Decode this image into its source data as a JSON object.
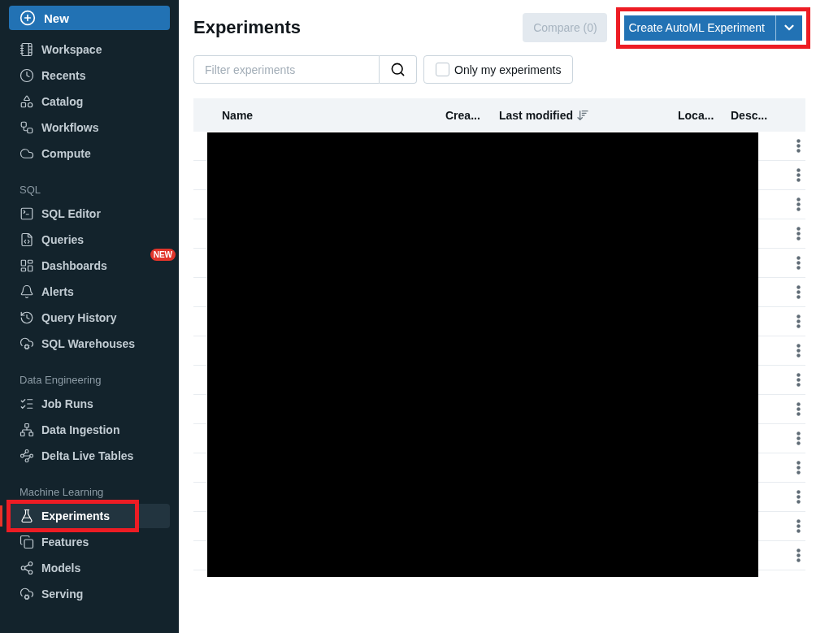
{
  "sidebar": {
    "new_button": {
      "label": "New"
    },
    "sections": [
      {
        "items": [
          {
            "label": "Workspace",
            "selected": false,
            "highlighted": false
          },
          {
            "label": "Recents",
            "selected": false,
            "highlighted": false
          },
          {
            "label": "Catalog",
            "selected": false,
            "highlighted": false
          },
          {
            "label": "Workflows",
            "selected": false,
            "highlighted": false
          },
          {
            "label": "Compute",
            "selected": false,
            "highlighted": false
          }
        ]
      },
      {
        "heading": "SQL",
        "items": [
          {
            "label": "SQL Editor",
            "selected": false,
            "highlighted": false
          },
          {
            "label": "Queries",
            "selected": false,
            "highlighted": false
          },
          {
            "label": "Dashboards",
            "selected": false,
            "highlighted": false,
            "badge": "NEW"
          },
          {
            "label": "Alerts",
            "selected": false,
            "highlighted": false
          },
          {
            "label": "Query History",
            "selected": false,
            "highlighted": false
          },
          {
            "label": "SQL Warehouses",
            "selected": false,
            "highlighted": false
          }
        ]
      },
      {
        "heading": "Data Engineering",
        "items": [
          {
            "label": "Job Runs",
            "selected": false,
            "highlighted": false
          },
          {
            "label": "Data Ingestion",
            "selected": false,
            "highlighted": false
          },
          {
            "label": "Delta Live Tables",
            "selected": false,
            "highlighted": false
          }
        ]
      },
      {
        "heading": "Machine Learning",
        "items": [
          {
            "label": "Experiments",
            "selected": true,
            "highlighted": true
          },
          {
            "label": "Features",
            "selected": false,
            "highlighted": false
          },
          {
            "label": "Models",
            "selected": false,
            "highlighted": false
          },
          {
            "label": "Serving",
            "selected": false,
            "highlighted": false
          }
        ]
      }
    ]
  },
  "page": {
    "title": "Experiments",
    "compare_button": {
      "label": "Compare (0)",
      "disabled": true
    },
    "create_button": {
      "label": "Create AutoML Experiment",
      "highlighted": true
    },
    "filter": {
      "placeholder": "Filter experiments"
    },
    "only_mine": {
      "label": "Only my experiments",
      "checked": false
    }
  },
  "table": {
    "columns": [
      {
        "label": "Name",
        "sorted": false
      },
      {
        "label": "Crea...",
        "sorted": false
      },
      {
        "label": "Last modified",
        "sorted": true
      },
      {
        "label": "Loca...",
        "sorted": false
      },
      {
        "label": "Desc...",
        "sorted": false
      }
    ],
    "redacted": true
  }
}
